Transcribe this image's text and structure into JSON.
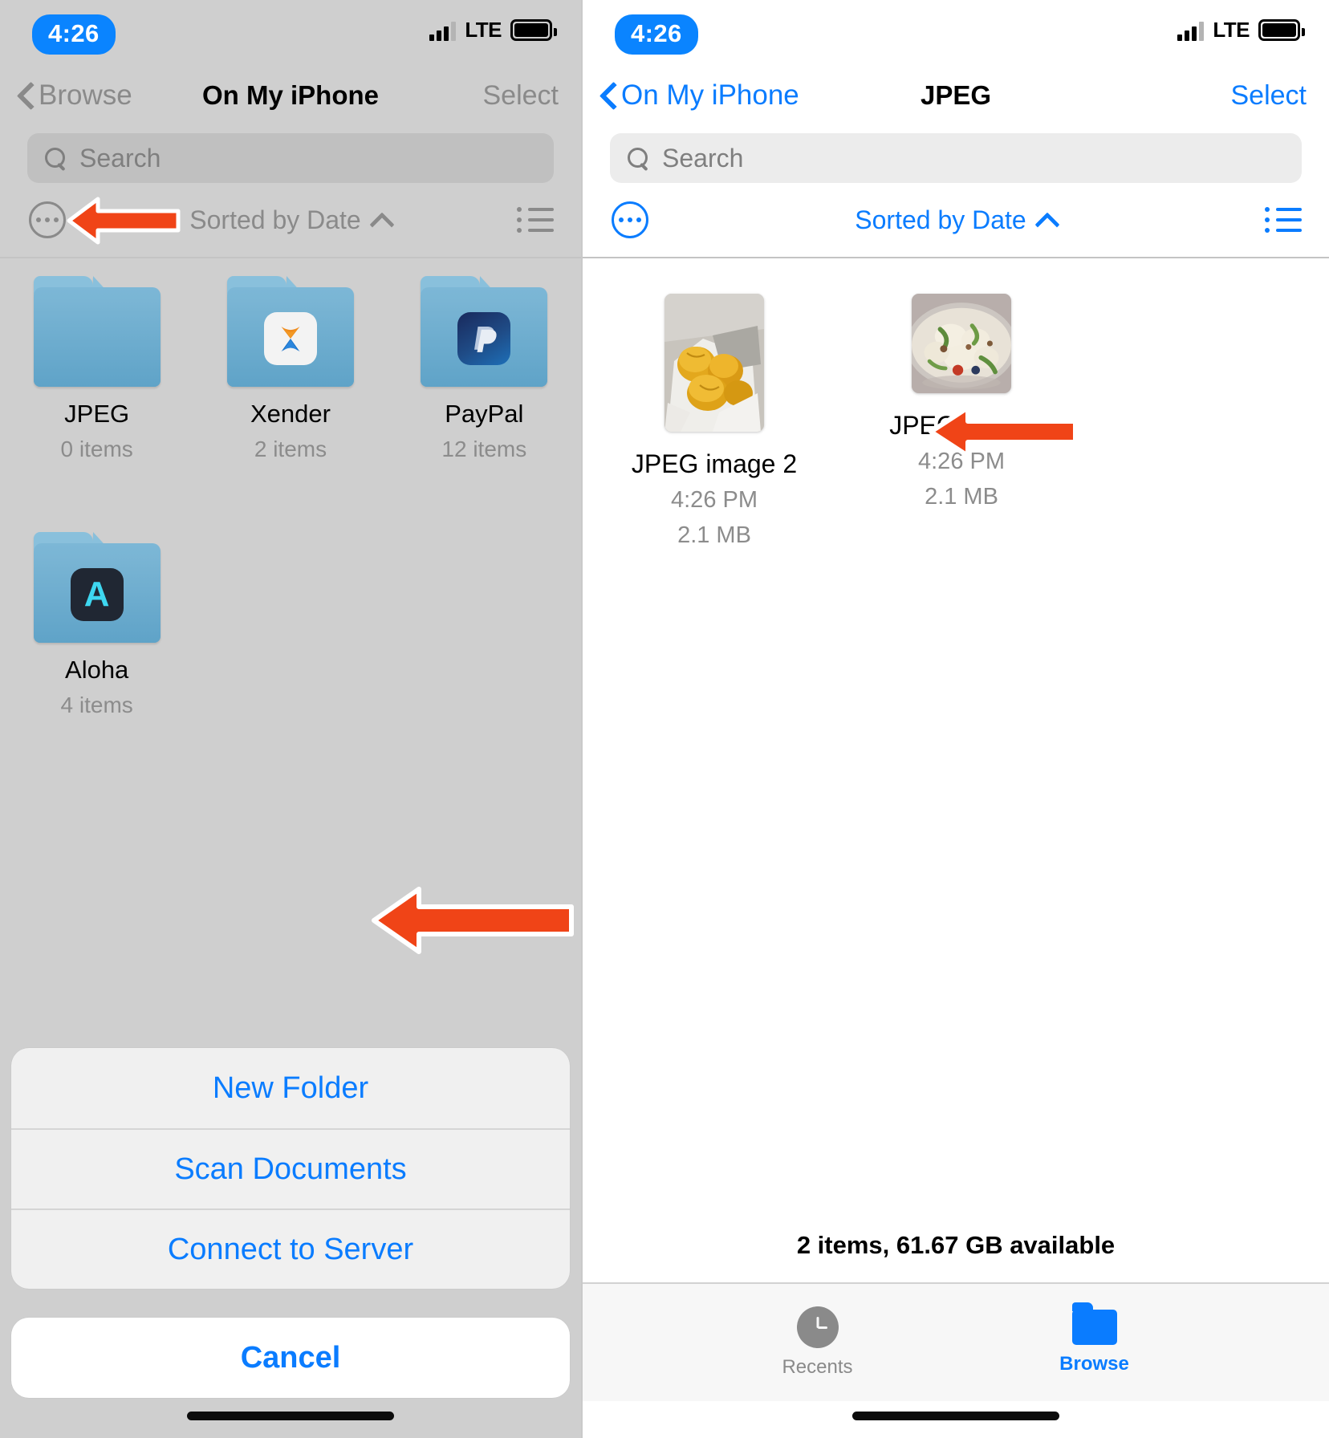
{
  "left": {
    "status": {
      "time": "4:26",
      "network": "LTE",
      "signal_icon": "signal-bars-icon",
      "battery_icon": "battery-icon"
    },
    "nav": {
      "back_label": "Browse",
      "title": "On My iPhone",
      "action_label": "Select"
    },
    "search": {
      "placeholder": "Search",
      "icon": "search-icon"
    },
    "toolbar": {
      "more_icon": "ellipsis-circle-icon",
      "sort_label": "Sorted by Date",
      "sort_caret": "caret-up-icon",
      "view_icon": "list-view-icon"
    },
    "folders": [
      {
        "name": "JPEG",
        "count": "0 items",
        "badge": "none"
      },
      {
        "name": "Xender",
        "count": "2 items",
        "badge": "xender-app-icon"
      },
      {
        "name": "PayPal",
        "count": "12 items",
        "badge": "paypal-app-icon"
      },
      {
        "name": "Aloha",
        "count": "4 items",
        "badge": "aloha-app-icon",
        "badge_letter": "A"
      }
    ],
    "action_sheet": {
      "items": [
        "New Folder",
        "Scan Documents",
        "Connect to Server"
      ],
      "cancel": "Cancel"
    }
  },
  "right": {
    "status": {
      "time": "4:26",
      "network": "LTE",
      "signal_icon": "signal-bars-icon",
      "battery_icon": "battery-icon"
    },
    "nav": {
      "back_label": "On My iPhone",
      "title": "JPEG",
      "action_label": "Select"
    },
    "search": {
      "placeholder": "Search",
      "icon": "search-icon"
    },
    "toolbar": {
      "more_icon": "ellipsis-circle-icon",
      "sort_label": "Sorted by Date",
      "sort_caret": "caret-up-icon",
      "view_icon": "list-view-icon"
    },
    "files": [
      {
        "name": "JPEG image 2",
        "time": "4:26 PM",
        "size": "2.1 MB",
        "thumb": "fried-dumplings-photo"
      },
      {
        "name": "JPEG image",
        "time": "4:26 PM",
        "size": "2.1 MB",
        "thumb": "pasta-salad-photo"
      }
    ],
    "storage_status": "2 items, 61.67 GB available",
    "tabs": [
      {
        "label": "Recents",
        "icon": "clock-icon",
        "active": false
      },
      {
        "label": "Browse",
        "icon": "folder-icon",
        "active": true
      }
    ]
  },
  "annotations": {
    "arrow_color": "#f04417",
    "arrows": [
      "points-to-more-button",
      "points-to-new-folder",
      "points-to-jpeg-image"
    ]
  },
  "colors": {
    "accent": "#0a7cff",
    "dim_overlay": "#cfcfcf",
    "sheet_bg": "#f0f0f0",
    "arrow": "#f04417"
  }
}
